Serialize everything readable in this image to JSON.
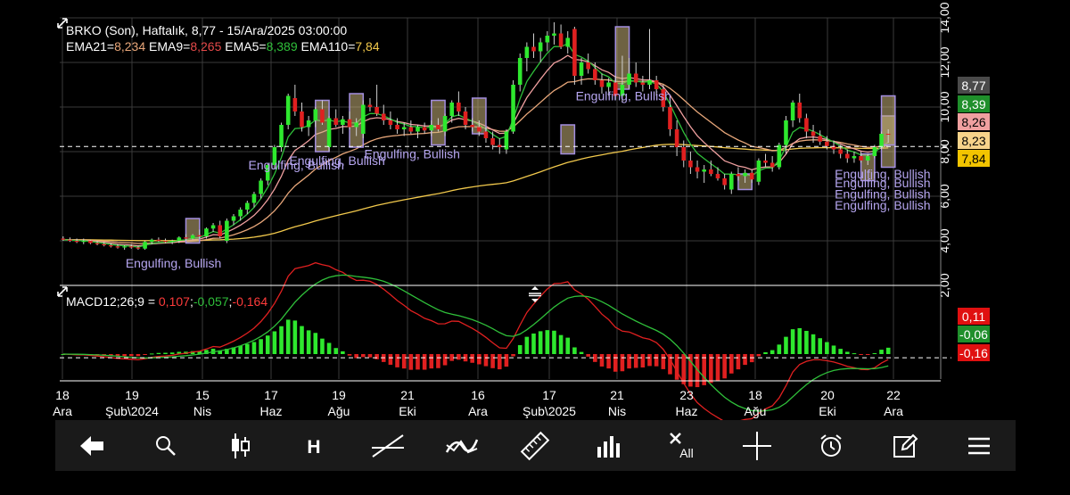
{
  "header": {
    "symbol_line": "BRKO (Son), Haftalık, 8,77 - 15/Ara/2025 03:00:00",
    "ema": [
      {
        "label": "EMA21=",
        "value": "8,234",
        "color": "#e8a77a"
      },
      {
        "label": " EMA9=",
        "value": "8,265",
        "color": "#e64a4a"
      },
      {
        "label": " EMA5=",
        "value": "8,389",
        "color": "#2fbf3a"
      },
      {
        "label": " EMA110=",
        "value": "7,84",
        "color": "#f2c94c"
      }
    ],
    "macd_label": "MACD12;26;9 = ",
    "macd_values": [
      {
        "text": "0,107",
        "color": "#ff3b3b"
      },
      {
        "text": ";",
        "color": "#ffffff"
      },
      {
        "text": "-0,057",
        "color": "#2fbf3a"
      },
      {
        "text": ";",
        "color": "#ffffff"
      },
      {
        "text": "-0,164",
        "color": "#ff3b3b"
      }
    ]
  },
  "price_badges": [
    {
      "text": "8,77",
      "bg": "#4a4a4a",
      "fg": "#ffffff",
      "value": 8.77
    },
    {
      "text": "8,39",
      "bg": "#1f8f2b",
      "fg": "#ffffff",
      "value": 8.39
    },
    {
      "text": "8,26",
      "bg": "#f0a0a0",
      "fg": "#000000",
      "value": 8.26
    },
    {
      "text": "8,23",
      "bg": "#f7d38a",
      "fg": "#000000",
      "value": 8.23
    },
    {
      "text": "7,84",
      "bg": "#f2c400",
      "fg": "#000000",
      "value": 7.84
    }
  ],
  "macd_badges": [
    {
      "text": "0,11",
      "bg": "#e01010",
      "fg": "#ffffff"
    },
    {
      "text": "-0,06",
      "bg": "#1f8f2b",
      "fg": "#ffffff"
    },
    {
      "text": "-0,16",
      "bg": "#e01010",
      "fg": "#ffffff"
    }
  ],
  "colors": {
    "up": "#2ee82e",
    "down": "#e02020",
    "ema5": "#2fbf3a",
    "ema9": "#f0a0a0",
    "ema21": "#e8a77a",
    "ema110": "#f2c94c",
    "pattern_fill": "#c9b27a",
    "pattern_stroke": "#a38ee0",
    "pattern_text": "#b6a6f0",
    "grid": "#3a3a3a"
  },
  "toolbar": [
    {
      "icon": "back-arrow-icon"
    },
    {
      "icon": "search-icon"
    },
    {
      "icon": "candlestick-icon"
    },
    {
      "icon": "h-icon",
      "label": "H"
    },
    {
      "icon": "trendline-icon"
    },
    {
      "icon": "indicator-icon"
    },
    {
      "icon": "ruler-icon"
    },
    {
      "icon": "bar-chart-icon"
    },
    {
      "icon": "delete-all-icon",
      "label": "All"
    },
    {
      "icon": "crosshair-icon"
    },
    {
      "icon": "alarm-icon"
    },
    {
      "icon": "edit-icon"
    },
    {
      "icon": "menu-icon"
    }
  ],
  "chart_data": {
    "type": "candlestick",
    "title": "BRKO (Son), Haftalık, 8,77 - 15/Ara/2025 03:00:00",
    "y_ticks": [
      "14,00",
      "12,00",
      "10,00",
      "8,00",
      "6,00",
      "4,00",
      "2,00"
    ],
    "ylim": [
      2.0,
      14.0
    ],
    "x_ticks": [
      {
        "day": "18",
        "month": "Ara"
      },
      {
        "day": "19",
        "month": "Şub\\2024"
      },
      {
        "day": "15",
        "month": "Nis"
      },
      {
        "day": "17",
        "month": "Haz"
      },
      {
        "day": "19",
        "month": "Ağu"
      },
      {
        "day": "21",
        "month": "Eki"
      },
      {
        "day": "16",
        "month": "Ara"
      },
      {
        "day": "17",
        "month": "Şub\\2025"
      },
      {
        "day": "21",
        "month": "Nis"
      },
      {
        "day": "23",
        "month": "Haz"
      },
      {
        "day": "18",
        "month": "Ağu"
      },
      {
        "day": "20",
        "month": "Eki"
      },
      {
        "day": "22",
        "month": "Ara"
      }
    ],
    "current_price": 8.23,
    "candles": [
      [
        4.1,
        4.2,
        4.0,
        4.05
      ],
      [
        4.05,
        4.15,
        3.95,
        4.0
      ],
      [
        4.0,
        4.1,
        3.9,
        3.95
      ],
      [
        3.95,
        4.1,
        3.85,
        4.0
      ],
      [
        4.0,
        4.05,
        3.85,
        3.9
      ],
      [
        3.9,
        4.0,
        3.8,
        3.85
      ],
      [
        3.85,
        3.95,
        3.75,
        3.8
      ],
      [
        3.8,
        3.9,
        3.7,
        3.75
      ],
      [
        3.75,
        3.85,
        3.65,
        3.7
      ],
      [
        3.7,
        3.8,
        3.6,
        3.75
      ],
      [
        3.75,
        3.85,
        3.65,
        3.7
      ],
      [
        3.7,
        3.8,
        3.6,
        3.65
      ],
      [
        3.65,
        4.0,
        3.6,
        3.95
      ],
      [
        3.95,
        4.1,
        3.85,
        4.05
      ],
      [
        4.05,
        4.15,
        3.95,
        4.0
      ],
      [
        4.0,
        4.1,
        3.9,
        3.95
      ],
      [
        3.95,
        4.05,
        3.85,
        4.0
      ],
      [
        4.0,
        4.2,
        3.9,
        4.15
      ],
      [
        4.15,
        4.3,
        4.0,
        4.1
      ],
      [
        4.1,
        4.3,
        4.05,
        4.25
      ],
      [
        4.25,
        4.5,
        4.1,
        4.2
      ],
      [
        4.2,
        4.6,
        4.1,
        4.55
      ],
      [
        4.55,
        4.8,
        4.4,
        4.7
      ],
      [
        4.7,
        4.9,
        4.1,
        4.2
      ],
      [
        4.0,
        5.0,
        3.9,
        4.9
      ],
      [
        4.9,
        5.2,
        4.7,
        5.1
      ],
      [
        5.1,
        5.5,
        4.9,
        5.4
      ],
      [
        5.4,
        5.8,
        5.2,
        5.7
      ],
      [
        5.7,
        6.2,
        5.5,
        6.1
      ],
      [
        6.1,
        6.8,
        5.9,
        6.7
      ],
      [
        6.7,
        7.5,
        6.5,
        7.4
      ],
      [
        7.4,
        8.3,
        7.2,
        8.2
      ],
      [
        8.2,
        9.3,
        8.0,
        9.2
      ],
      [
        9.2,
        10.6,
        9.0,
        10.5
      ],
      [
        10.4,
        11.0,
        9.6,
        9.8
      ],
      [
        9.8,
        10.2,
        8.9,
        9.1
      ],
      [
        9.1,
        9.6,
        8.7,
        9.4
      ],
      [
        9.4,
        10.0,
        9.1,
        9.9
      ],
      [
        9.9,
        10.3,
        9.2,
        9.3
      ],
      [
        8.2,
        9.6,
        8.0,
        9.5
      ],
      [
        9.5,
        9.9,
        9.1,
        9.2
      ],
      [
        9.2,
        9.6,
        8.8,
        9.45
      ],
      [
        9.45,
        9.8,
        9.0,
        9.1
      ],
      [
        9.1,
        9.5,
        8.7,
        9.3
      ],
      [
        8.8,
        10.3,
        8.6,
        10.1
      ],
      [
        10.1,
        10.4,
        9.8,
        10.0
      ],
      [
        10.0,
        11.0,
        9.6,
        9.7
      ],
      [
        9.7,
        10.1,
        9.2,
        9.4
      ],
      [
        9.4,
        9.8,
        9.0,
        9.2
      ],
      [
        9.2,
        9.5,
        8.8,
        9.0
      ],
      [
        9.0,
        9.3,
        8.7,
        9.1
      ],
      [
        9.1,
        9.4,
        8.8,
        8.9
      ],
      [
        8.9,
        9.2,
        8.6,
        9.1
      ],
      [
        9.1,
        9.3,
        8.8,
        8.95
      ],
      [
        8.95,
        9.4,
        8.7,
        9.2
      ],
      [
        9.2,
        9.5,
        8.9,
        9.0
      ],
      [
        8.9,
        9.7,
        8.7,
        9.6
      ],
      [
        9.6,
        10.3,
        9.3,
        10.2
      ],
      [
        10.2,
        10.7,
        9.6,
        9.8
      ],
      [
        9.8,
        10.0,
        9.0,
        9.2
      ],
      [
        9.2,
        9.5,
        8.9,
        9.1
      ],
      [
        9.1,
        9.4,
        8.7,
        8.9
      ],
      [
        8.9,
        9.1,
        8.4,
        8.6
      ],
      [
        8.6,
        8.9,
        8.1,
        8.3
      ],
      [
        8.3,
        8.6,
        7.9,
        8.2
      ],
      [
        8.1,
        9.0,
        7.9,
        8.9
      ],
      [
        8.9,
        11.2,
        8.8,
        11.0
      ],
      [
        11.0,
        12.4,
        10.7,
        12.2
      ],
      [
        12.2,
        12.9,
        11.6,
        12.7
      ],
      [
        12.7,
        13.3,
        12.2,
        12.5
      ],
      [
        12.5,
        13.1,
        12.0,
        12.9
      ],
      [
        12.9,
        13.4,
        12.5,
        13.2
      ],
      [
        13.2,
        13.8,
        12.8,
        13.3
      ],
      [
        13.3,
        13.7,
        12.6,
        12.7
      ],
      [
        12.7,
        13.4,
        12.4,
        13.1
      ],
      [
        13.5,
        13.6,
        11.0,
        11.4
      ],
      [
        11.4,
        12.2,
        11.0,
        12.0
      ],
      [
        12.0,
        12.4,
        11.5,
        11.7
      ],
      [
        11.7,
        12.0,
        11.0,
        11.2
      ],
      [
        11.2,
        11.5,
        10.6,
        10.9
      ],
      [
        10.9,
        11.3,
        10.5,
        11.1
      ],
      [
        11.1,
        11.4,
        10.3,
        10.5
      ],
      [
        10.5,
        12.3,
        10.2,
        11.0
      ],
      [
        11.0,
        12.2,
        10.8,
        11.5
      ],
      [
        11.5,
        12.0,
        10.9,
        11.1
      ],
      [
        11.1,
        11.4,
        10.7,
        11.0
      ],
      [
        11.0,
        13.5,
        10.8,
        11.2
      ],
      [
        11.2,
        11.4,
        10.5,
        10.8
      ],
      [
        10.8,
        11.0,
        9.8,
        10.0
      ],
      [
        10.0,
        10.4,
        8.7,
        9.0
      ],
      [
        9.0,
        9.4,
        7.8,
        8.2
      ],
      [
        8.2,
        8.5,
        7.3,
        7.6
      ],
      [
        7.6,
        8.0,
        7.0,
        7.3
      ],
      [
        7.3,
        7.6,
        6.8,
        7.1
      ],
      [
        7.1,
        7.4,
        6.6,
        7.2
      ],
      [
        7.2,
        7.6,
        6.9,
        7.0
      ],
      [
        7.0,
        7.3,
        6.7,
        6.8
      ],
      [
        6.8,
        7.0,
        6.3,
        6.5
      ],
      [
        6.3,
        7.1,
        6.1,
        7.0
      ],
      [
        7.0,
        7.3,
        6.7,
        6.9
      ],
      [
        6.9,
        7.2,
        6.6,
        7.05
      ],
      [
        7.05,
        7.2,
        6.6,
        6.75
      ],
      [
        6.65,
        7.7,
        6.5,
        7.6
      ],
      [
        7.6,
        7.9,
        7.3,
        7.5
      ],
      [
        7.5,
        7.8,
        7.1,
        7.3
      ],
      [
        7.3,
        8.4,
        7.2,
        8.3
      ],
      [
        8.3,
        9.6,
        7.9,
        9.4
      ],
      [
        9.4,
        10.3,
        9.1,
        10.2
      ],
      [
        10.2,
        10.6,
        9.3,
        9.5
      ],
      [
        9.5,
        9.7,
        8.6,
        8.9
      ],
      [
        8.9,
        9.2,
        8.4,
        8.7
      ],
      [
        8.7,
        8.95,
        8.3,
        8.45
      ],
      [
        8.45,
        8.7,
        8.1,
        8.25
      ],
      [
        8.25,
        8.5,
        7.9,
        8.1
      ],
      [
        8.1,
        8.3,
        7.7,
        7.9
      ],
      [
        7.9,
        8.1,
        7.5,
        7.7
      ],
      [
        7.7,
        8.0,
        7.5,
        7.8
      ],
      [
        7.8,
        8.0,
        7.5,
        7.6
      ],
      [
        7.6,
        7.9,
        7.4,
        7.8
      ],
      [
        7.8,
        8.3,
        7.7,
        8.2
      ],
      [
        8.2,
        8.9,
        8.1,
        8.8
      ],
      [
        8.8,
        9.0,
        8.4,
        8.77
      ]
    ],
    "pattern_boxes": [
      {
        "start": 24,
        "end": 24,
        "low": 3.9,
        "high": 5.0
      },
      {
        "start": 48,
        "end": 48,
        "low": 8.0,
        "high": 10.3
      },
      {
        "start": 54,
        "end": 54,
        "low": 8.2,
        "high": 10.6
      },
      {
        "start": 69,
        "end": 69,
        "low": 8.3,
        "high": 10.3
      },
      {
        "start": 77,
        "end": 77,
        "low": 8.8,
        "high": 10.4
      },
      {
        "start": 93,
        "end": 93,
        "low": 7.9,
        "high": 9.2
      },
      {
        "start": 116,
        "end": 116,
        "low": 10.8,
        "high": 13.6
      },
      {
        "start": 165,
        "end": 165,
        "low": 6.3,
        "high": 7.0
      },
      {
        "start": 177,
        "end": 177,
        "low": 6.7,
        "high": 7.9
      },
      {
        "start": 189,
        "end": 189,
        "low": 7.3,
        "high": 9.6
      },
      {
        "start": 194,
        "end": 194,
        "low": 8.3,
        "high": 10.5
      }
    ],
    "pattern_labels": [
      {
        "text": "Engulfing, Bullish",
        "index": 20,
        "value": 2.8
      },
      {
        "text": "Engulfing, Bullish",
        "index": 44,
        "value": 7.2
      },
      {
        "text": "Engulfing, Bullish",
        "index": 52,
        "value": 7.4
      },
      {
        "text": "Engulfing, Bullish",
        "index": 73,
        "value": 7.7
      },
      {
        "text": "Engulfing, Bullish",
        "index": 102,
        "value": 10.3
      },
      {
        "text": "Engulfing, Bullish",
        "index": 153,
        "value": 5.4
      },
      {
        "text": "Engulfing, Bullish",
        "index": 162,
        "value": 5.9
      },
      {
        "text": "Engulfing, Bullish",
        "index": 170,
        "value": 6.4
      },
      {
        "text": "Engulfing, Bullish",
        "index": 178,
        "value": 6.8
      }
    ],
    "macd": {
      "ylim": [
        -0.9,
        0.9
      ],
      "signal_value": -0.06
    }
  }
}
